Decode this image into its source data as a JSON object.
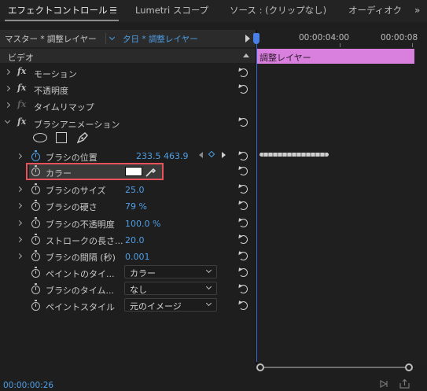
{
  "tabs": [
    {
      "label": "エフェクトコントロール"
    },
    {
      "label": "Lumetri スコープ"
    },
    {
      "label": "ソース : (クリップなし)"
    },
    {
      "label": "オーディオク"
    }
  ],
  "tab_menu_icon": "hamburger-icon",
  "overflow_icon": "double-chevron-right-icon",
  "header": {
    "master": "マスター * 調整レイヤー",
    "source": "夕日 * 調整レイヤー"
  },
  "timeline": {
    "time_start": "00:00:04:00",
    "time_end": "00:00:08",
    "clip_label": "調整レイヤー",
    "clip_color": "#d97fde",
    "playhead_color": "#3a6fd8"
  },
  "section_label": "ビデオ",
  "effects": [
    {
      "name": "モーション"
    },
    {
      "name": "不透明度"
    },
    {
      "name": "タイムリマップ"
    },
    {
      "name": "ブラシアニメーション"
    }
  ],
  "brush_tools": [
    "ellipse-icon",
    "rectangle-icon",
    "pen-icon"
  ],
  "params": {
    "brush_position": {
      "label": "ブラシの位置",
      "x": "233.5",
      "y": "463.9"
    },
    "color": {
      "label": "カラー",
      "swatch": "#ffffff"
    },
    "brush_size": {
      "label": "ブラシのサイズ",
      "value": "25.0"
    },
    "brush_hardness": {
      "label": "ブラシの硬さ",
      "value": "79 %"
    },
    "brush_opacity": {
      "label": "ブラシの不透明度",
      "value": "100.0 %"
    },
    "stroke_length": {
      "label": "ストロークの長さ...",
      "value": "20.0"
    },
    "brush_interval": {
      "label": "ブラシの間隔 (秒)",
      "value": "0.001"
    },
    "paint_time": {
      "label": "ペイントのタイ...",
      "value": "カラー"
    },
    "brush_time": {
      "label": "ブラシのタイム...",
      "value": "なし"
    },
    "paint_style": {
      "label": "ペイントスタイル",
      "value": "元のイメージ"
    }
  },
  "timecode": "00:00:00:26",
  "accent_blue": "#4f9fe6",
  "highlight_red": "#e8525a"
}
